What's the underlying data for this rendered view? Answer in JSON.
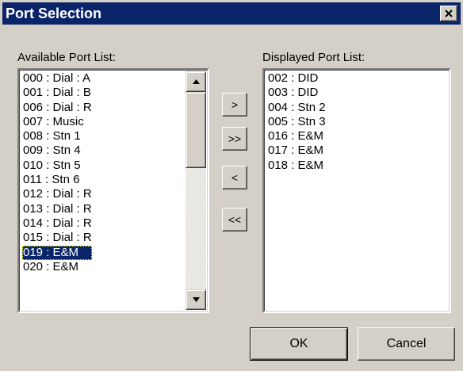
{
  "window": {
    "title": "Port Selection"
  },
  "available": {
    "label": "Available Port List:",
    "items": [
      "000 : Dial : A",
      "001 : Dial : B",
      "006 : Dial : R",
      "007 : Music",
      "008 : Stn 1",
      "009 : Stn 4",
      "010 : Stn 5",
      "011 : Stn 6",
      "012 : Dial : R",
      "013 : Dial : R",
      "014 : Dial : R",
      "015 : Dial : R",
      "019 : E&M",
      "020 : E&M"
    ],
    "selected_index": 12
  },
  "displayed": {
    "label": "Displayed Port List:",
    "items": [
      "002 : DID",
      "003 : DID",
      "004 : Stn 2",
      "005 : Stn 3",
      "016 : E&M",
      "017 : E&M",
      "018 : E&M"
    ]
  },
  "move_buttons": {
    "add": ">",
    "add_all": ">>",
    "remove": "<",
    "remove_all": "<<"
  },
  "buttons": {
    "ok": "OK",
    "cancel": "Cancel"
  },
  "colors": {
    "title_bar": "#0a246a",
    "dialog_face": "#d4d0c8",
    "selection": "#0a246a"
  }
}
